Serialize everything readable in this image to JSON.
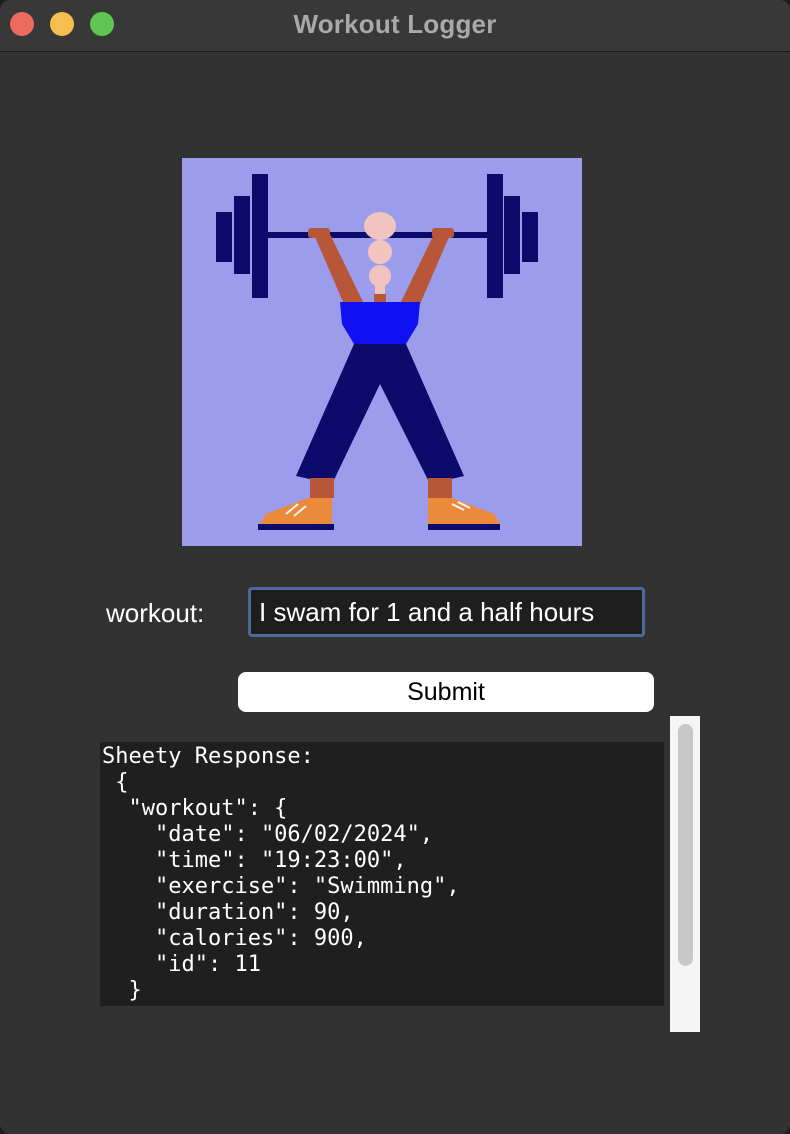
{
  "window": {
    "title": "Workout Logger"
  },
  "logo": {
    "description_icon": "weightlifter-icon",
    "background_color": "#9b9dec"
  },
  "form": {
    "workout_label": "workout:",
    "workout_value": "I swam for 1 and a half hours",
    "submit_label": "Submit"
  },
  "response": {
    "lines": [
      "Sheety Response:",
      " {",
      "  \"workout\": {",
      "    \"date\": \"06/02/2024\",",
      "    \"time\": \"19:23:00\",",
      "    \"exercise\": \"Swimming\",",
      "    \"duration\": 90,",
      "    \"calories\": 900,",
      "    \"id\": 11",
      "  }"
    ]
  },
  "colors": {
    "close": "#ec6a5e",
    "minimize": "#f4bf4f",
    "zoom": "#61c554",
    "input_border": "#4a6a9c"
  }
}
